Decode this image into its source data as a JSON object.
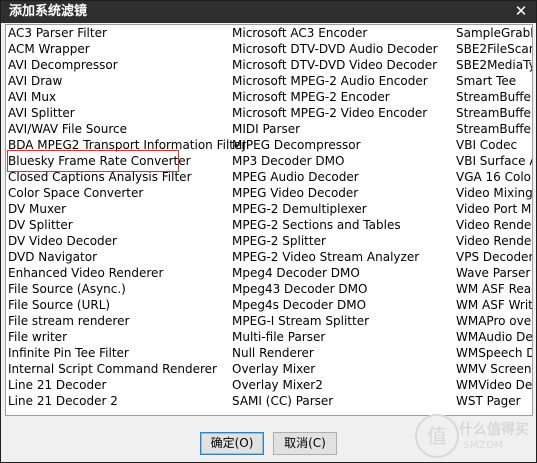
{
  "window": {
    "title": "添加系统滤镜",
    "close_glyph": "✕"
  },
  "list": {
    "col1": [
      "AC3 Parser Filter",
      "ACM Wrapper",
      "AVI Decompressor",
      "AVI Draw",
      "AVI Mux",
      "AVI Splitter",
      "AVI/WAV File Source",
      "BDA MPEG2 Transport Information Filter",
      "Bluesky Frame Rate Converter",
      "Closed Captions Analysis Filter",
      "Color Space Converter",
      "DV Muxer",
      "DV Splitter",
      "DV Video Decoder",
      "DVD Navigator",
      "Enhanced Video Renderer",
      "File Source (Async.)",
      "File Source (URL)",
      "File stream renderer",
      "File writer",
      "Infinite Pin Tee Filter",
      "Internal Script Command Renderer",
      "Line 21 Decoder",
      "Line 21 Decoder 2"
    ],
    "col2": [
      "Microsoft AC3 Encoder",
      "Microsoft DTV-DVD Audio Decoder",
      "Microsoft DTV-DVD Video Decoder",
      "Microsoft MPEG-2 Audio Encoder",
      "Microsoft MPEG-2 Encoder",
      "Microsoft MPEG-2 Video Encoder",
      "MIDI Parser",
      "MJPEG Decompressor",
      "MP3 Decoder DMO",
      "MPEG Audio Decoder",
      "MPEG Video Decoder",
      "MPEG-2 Demultiplexer",
      "MPEG-2 Sections and Tables",
      "MPEG-2 Splitter",
      "MPEG-2 Video Stream Analyzer",
      "Mpeg4 Decoder DMO",
      "Mpeg43 Decoder DMO",
      "Mpeg4s Decoder DMO",
      "MPEG-I Stream Splitter",
      "Multi-file Parser",
      "Null Renderer",
      "Overlay Mixer",
      "Overlay Mixer2",
      "SAMI (CC) Parser"
    ],
    "col3": [
      "SampleGrabbe",
      "SBE2FileScan",
      "SBE2MediaTyp",
      "Smart Tee",
      "StreamBufferS",
      "StreamBufferS",
      "StreamBufferS",
      "VBI Codec",
      "VBI Surface Al",
      "VGA 16 Color D",
      "Video Mixing R",
      "Video Port Ma",
      "Video Rendere",
      "Video Rendere",
      "VPS Decoder",
      "Wave Parser",
      "WM ASF Reade",
      "WM ASF Write",
      "WMAPro over",
      "WMAudio Dec",
      "WMSpeech De",
      "WMV Screen d",
      "WMVideo Dec",
      "WST Pager"
    ]
  },
  "buttons": {
    "ok": "确定(O)",
    "cancel": "取消(C)"
  },
  "watermark": {
    "glyph": "值",
    "text": "什么值得买",
    "sub": "SMZDM"
  }
}
